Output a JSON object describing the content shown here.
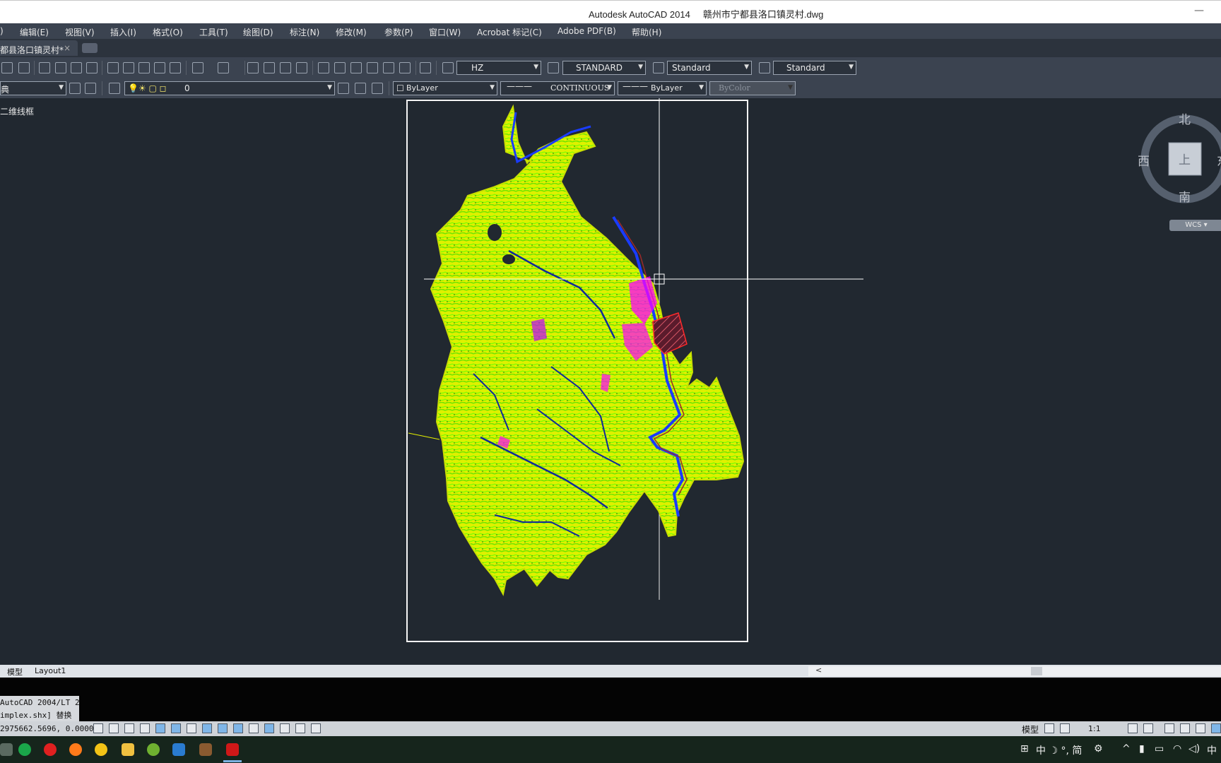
{
  "window": {
    "title": "Autodesk AutoCAD 2014     赣州市宁都县洛口镇灵村.dwg",
    "minimize_glyph": "—"
  },
  "menu": {
    "items": [
      ")",
      "编辑(E)",
      "视图(V)",
      "插入(I)",
      "格式(O)",
      "工具(T)",
      "绘图(D)",
      "标注(N)",
      "修改(M)",
      "参数(P)",
      "窗口(W)",
      "Acrobat 标记(C)",
      "Adobe PDF(B)",
      "帮助(H)"
    ]
  },
  "doc_tab": {
    "label": "都县洛口镇灵村*",
    "close": "×"
  },
  "toolbar1": {
    "text_style": "HZ",
    "dim_style": "STANDARD",
    "table_style": "Standard",
    "multileader_style": "Standard"
  },
  "toolbar2": {
    "workspace": "典",
    "layer": "0",
    "color": "ByLayer",
    "linetype": "CONTINUOUS",
    "lineweight": "ByLayer",
    "plotstyle": "ByColor"
  },
  "canvas": {
    "view_label": "二维线框",
    "background": "#212830",
    "viewcube": {
      "north": "北",
      "south": "南",
      "west": "西",
      "east": "东",
      "face": "上",
      "wcs": "WCS"
    }
  },
  "layout_tabs": {
    "model": "模型",
    "layout1": "Layout1",
    "scroll_left": "<"
  },
  "command": {
    "line1": "AutoCAD 2004/LT 2",
    "line2": "implex.shx] 替换"
  },
  "status": {
    "coords": "2975662.5696, 0.0000",
    "model_label": "模型",
    "annotation_scale": "1:1"
  },
  "taskbar": {
    "tray_text": "中 ☽ °, 简",
    "ime": "中"
  },
  "colors": {
    "terrain_yellow": "#e4f000",
    "terrain_green": "#7cff00",
    "water_blue": "#1a3cff",
    "magenta": "#ff00ff",
    "accent_red": "#ff2a2a"
  }
}
